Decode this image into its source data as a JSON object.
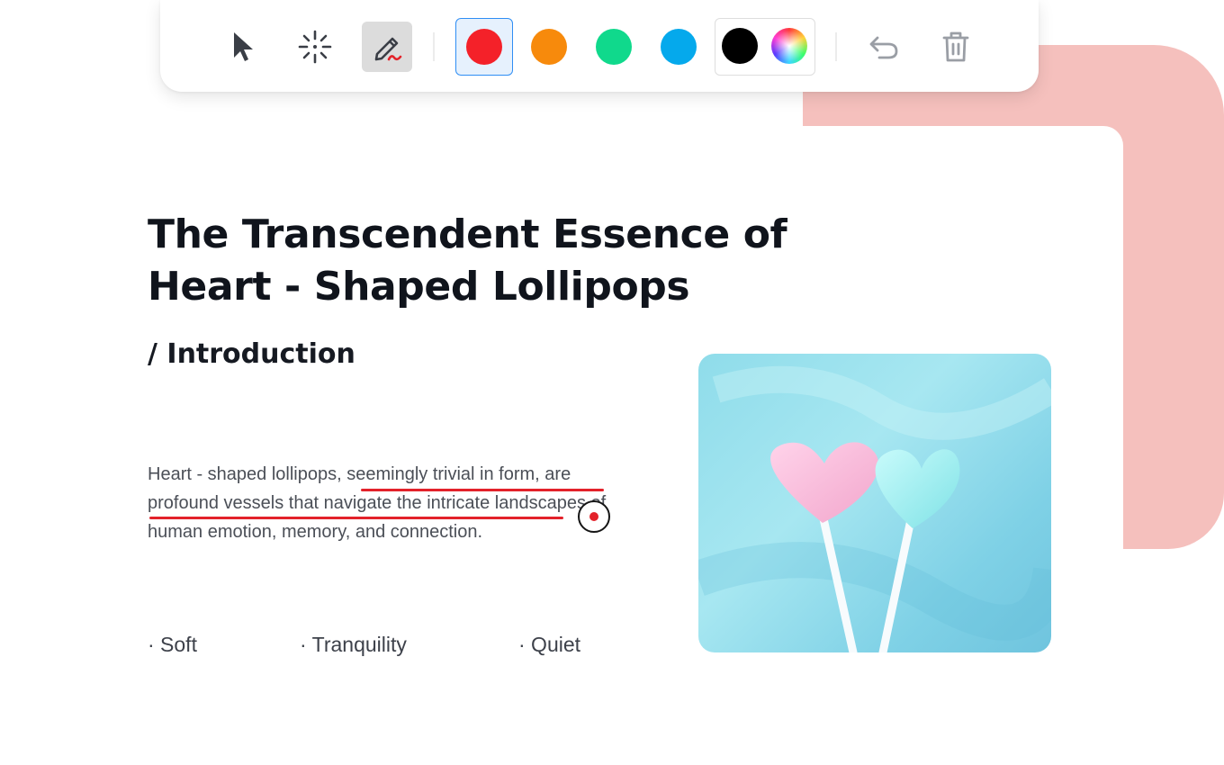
{
  "toolbar": {
    "tools": [
      {
        "name": "pointer",
        "icon": "cursor-arrow-icon"
      },
      {
        "name": "laser",
        "icon": "sparkle-burst-icon"
      },
      {
        "name": "pen",
        "icon": "pencil-scribble-icon",
        "active": true
      }
    ],
    "colors": [
      {
        "name": "red",
        "hex": "#f42129",
        "selected": true
      },
      {
        "name": "orange",
        "hex": "#f78a0c"
      },
      {
        "name": "green",
        "hex": "#10d98c"
      },
      {
        "name": "blue",
        "hex": "#05a9ec"
      }
    ],
    "custom_colors": [
      {
        "name": "black",
        "hex": "#000000"
      },
      {
        "name": "color-wheel",
        "icon": "color-wheel-icon"
      }
    ],
    "actions": [
      {
        "name": "undo",
        "icon": "undo-icon"
      },
      {
        "name": "clear",
        "icon": "trash-icon"
      }
    ]
  },
  "document": {
    "title": "The Transcendent Essence of\nHeart - Shaped Lollipops",
    "section": "/ Introduction",
    "paragraph": "Heart - shaped lollipops, seemingly trivial in form, are profound vessels that navigate the intricate landscapes of human emotion, memory, and connection.",
    "tags": [
      "· Soft",
      "· Tranquility",
      "· Quiet"
    ],
    "image_icon": "heart-lollipops-photo"
  },
  "annotation": {
    "stroke_color": "#e3222a",
    "marker_icon": "record-marker-icon"
  },
  "theme": {
    "accent_pink": "#f5c0bd",
    "selection_blue": "#2f8ef4"
  }
}
